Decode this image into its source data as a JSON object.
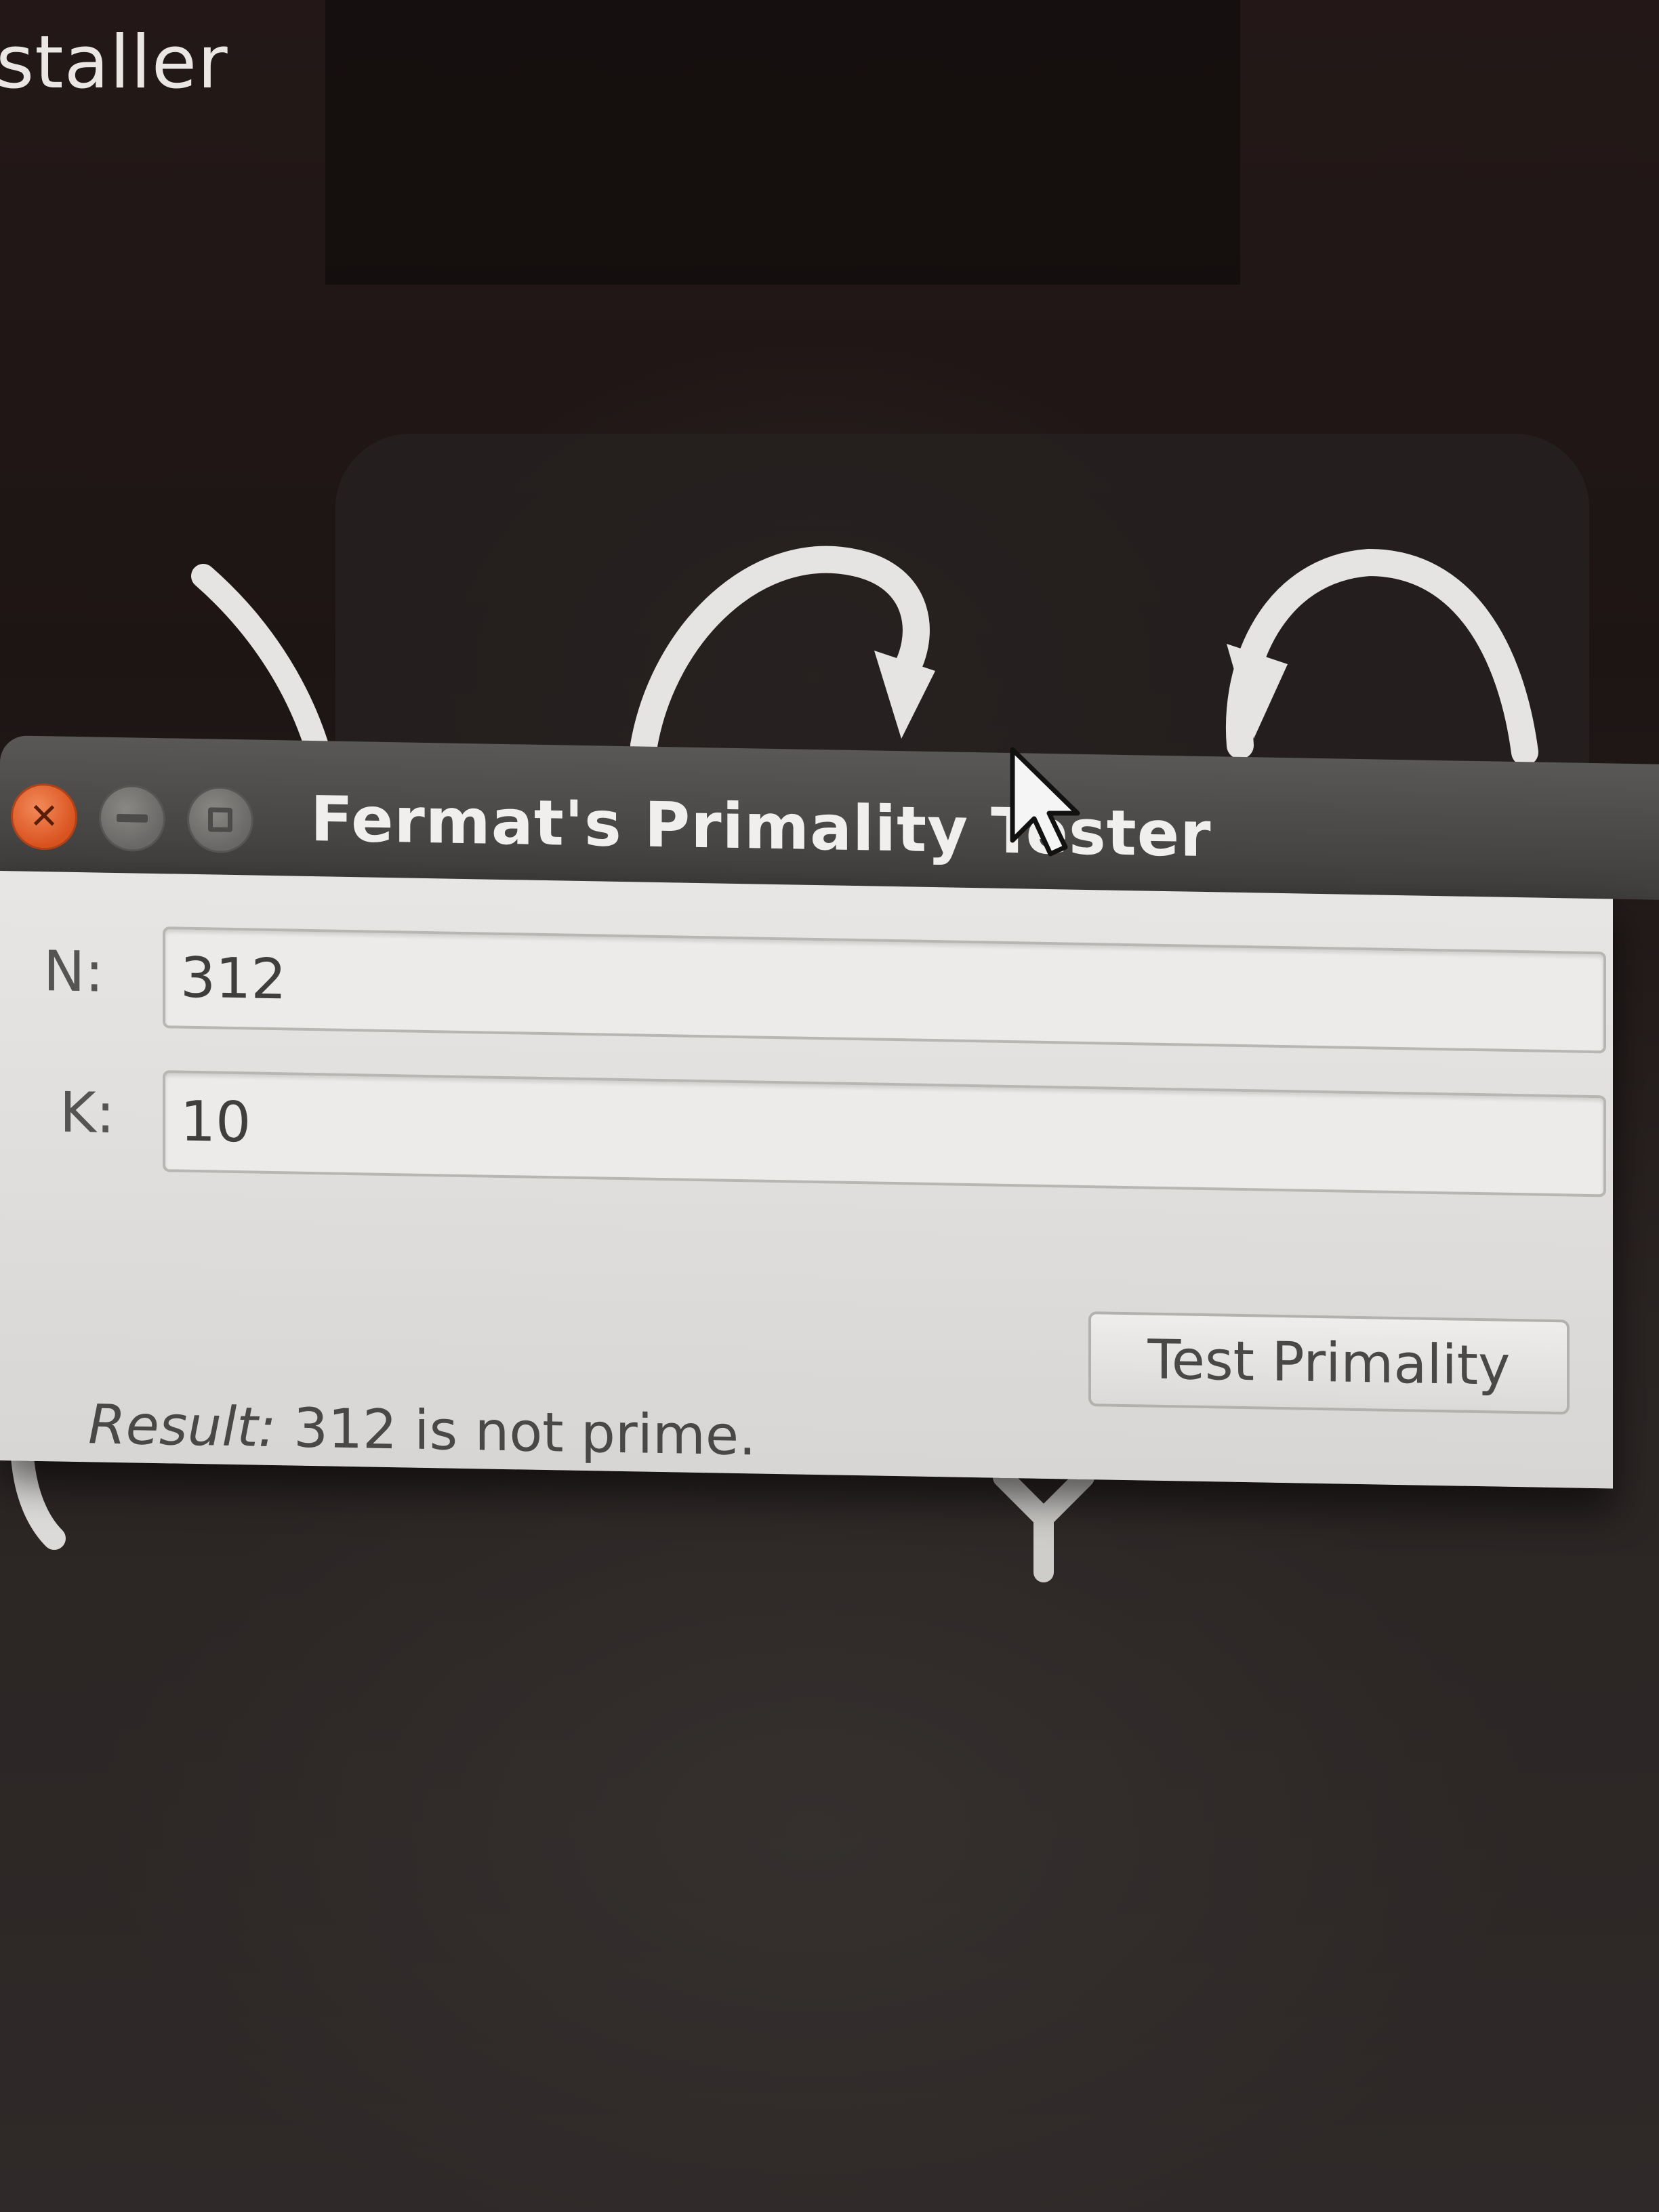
{
  "desktop": {
    "partial_label": "staller"
  },
  "window": {
    "title": "Fermat's Primality Tester",
    "controls": {
      "close_icon": "close-icon",
      "minimize_icon": "minimize-icon",
      "maximize_icon": "maximize-icon"
    }
  },
  "form": {
    "n_label": "N:",
    "n_value": "312",
    "k_label": "K:",
    "k_value": "10",
    "test_button_label": "Test Primality"
  },
  "result": {
    "label": "Result:",
    "text": "312 is not prime."
  },
  "colors": {
    "close_button": "#e0602a",
    "titlebar": "#4a4846",
    "dialog_body": "#e2e0de"
  }
}
